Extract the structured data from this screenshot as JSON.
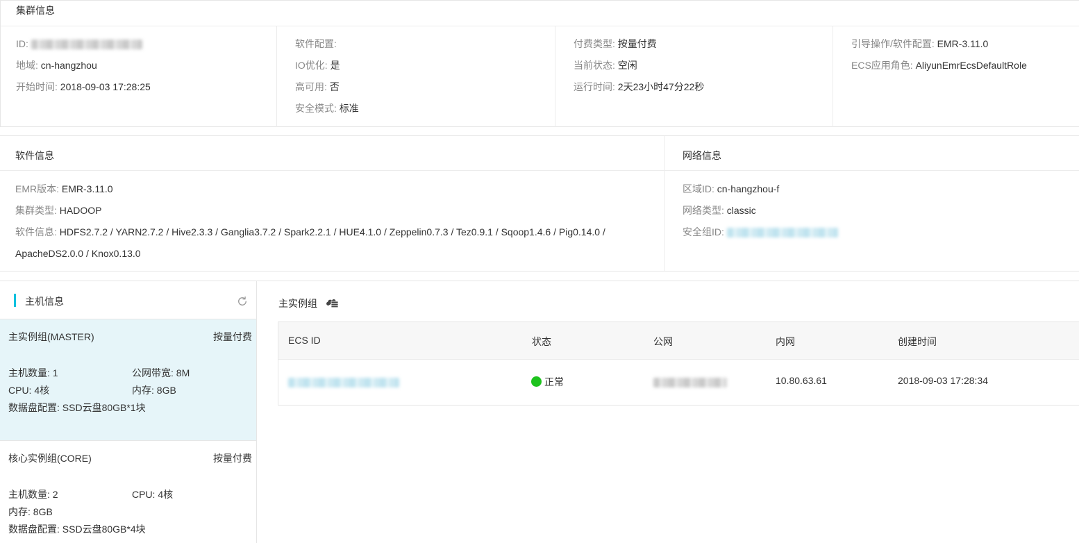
{
  "cluster": {
    "title": "集群信息",
    "col1": {
      "id_label": "ID:",
      "region_label": "地域:",
      "region_value": "cn-hangzhou",
      "start_label": "开始时间:",
      "start_value": "2018-09-03 17:28:25"
    },
    "col2": {
      "software_label": "软件配置:",
      "io_label": "IO优化:",
      "io_value": "是",
      "ha_label": "高可用:",
      "ha_value": "否",
      "security_label": "安全模式:",
      "security_value": "标准"
    },
    "col3": {
      "pay_label": "付费类型:",
      "pay_value": "按量付费",
      "status_label": "当前状态:",
      "status_value": "空闲",
      "runtime_label": "运行时间:",
      "runtime_value": "2天23小时47分22秒"
    },
    "col4": {
      "guide_label": "引导操作/软件配置:",
      "guide_value": "EMR-3.11.0",
      "role_label": "ECS应用角色:",
      "role_value": "AliyunEmrEcsDefaultRole"
    }
  },
  "software": {
    "title": "软件信息",
    "emr_label": "EMR版本:",
    "emr_value": "EMR-3.11.0",
    "type_label": "集群类型:",
    "type_value": "HADOOP",
    "info_label": "软件信息:",
    "info_line1": "HDFS2.7.2 / YARN2.7.2 / Hive2.3.3 / Ganglia3.7.2 / Spark2.2.1 / HUE4.1.0 / Zeppelin0.7.3 / Tez0.9.1 / Sqoop1.4.6 / Pig0.14.0 /",
    "info_line2": "ApacheDS2.0.0 / Knox0.13.0"
  },
  "network": {
    "title": "网络信息",
    "zone_label": "区域ID:",
    "zone_value": "cn-hangzhou-f",
    "nettype_label": "网络类型:",
    "nettype_value": "classic",
    "sg_label": "安全组ID:"
  },
  "hosts": {
    "title": "主机信息",
    "groups": [
      {
        "name": "主实例组(MASTER)",
        "pay": "按量付费",
        "count": "主机数量: 1",
        "bandwidth": "公网带宽: 8M",
        "cpu": "CPU: 4核",
        "memory": "内存: 8GB",
        "disk": "数据盘配置: SSD云盘80GB*1块"
      },
      {
        "name": "核心实例组(CORE)",
        "pay": "按量付费",
        "count": "主机数量: 2",
        "cpu": "CPU: 4核",
        "memory": "内存: 8GB",
        "disk": "数据盘配置: SSD云盘80GB*4块"
      }
    ]
  },
  "instances": {
    "title": "主实例组",
    "columns": [
      "ECS ID",
      "状态",
      "公网",
      "内网",
      "创建时间"
    ],
    "rows": [
      {
        "status": "正常",
        "private_ip": "10.80.63.61",
        "created": "2018-09-03 17:28:34"
      }
    ],
    "status_color": "#1ec31e"
  }
}
